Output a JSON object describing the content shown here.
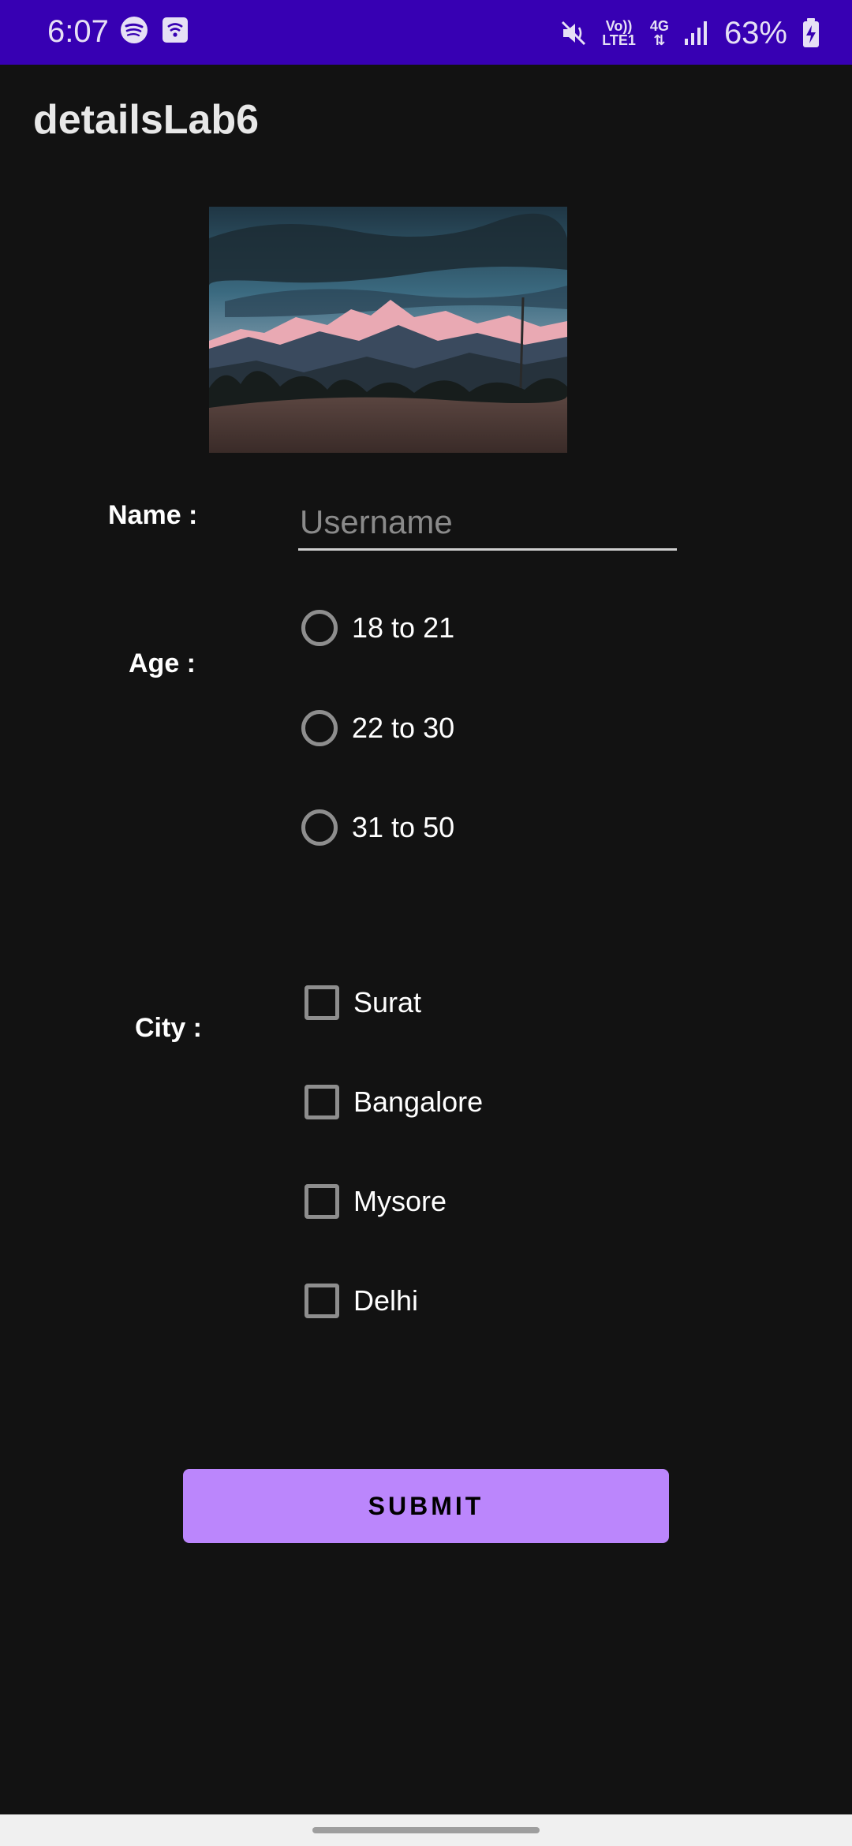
{
  "status_bar": {
    "time": "6:07",
    "battery_percent": "63%",
    "network_top": "Vo))",
    "network_bottom": "LTE1",
    "network_type": "4G",
    "icons": [
      "spotify-icon",
      "wifi-calling-icon",
      "mute-vibrate-icon",
      "volte-icon",
      "4g-data-icon",
      "signal-icon",
      "battery-charging-icon"
    ]
  },
  "app": {
    "title": "detailsLab6"
  },
  "form": {
    "name_label": "Name :",
    "name_placeholder": "Username",
    "name_value": "",
    "age_label": "Age :",
    "age_options": [
      "18 to 21",
      "22 to 30",
      "31 to 50"
    ],
    "city_label": "City :",
    "city_options": [
      "Surat",
      "Bangalore",
      "Mysore",
      "Delhi"
    ],
    "submit_label": "SUBMIT"
  },
  "colors": {
    "status_bar": "#3700b3",
    "background": "#121212",
    "accent": "#bb86fc"
  }
}
